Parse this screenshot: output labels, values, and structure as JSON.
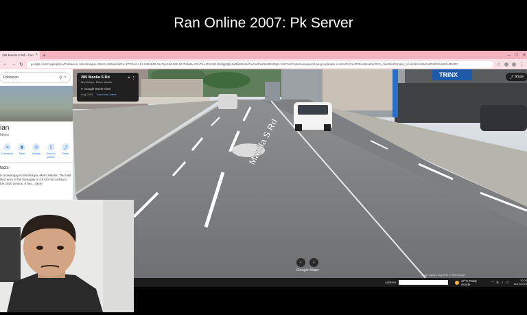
{
  "stream": {
    "title": "Ran Online 2007: Pk Server"
  },
  "browser": {
    "tab_label": "285 Manila S Rd - Google Maps",
    "url": "google.com/maps/place/Poblacion,+Muntinlupa,+Metro+Manila/@14.3770110,121.0464565,3a,75y,346.05h,90.7t/data=!3m7!1e1!3m5!1sMUjgNjwUwlBkWmU4CuCw0hw!2e0!6shttps:%2F%2Fstreetviewpixels-pa.googleapis.com%2Fv1%2Fthumbnail%3Fcb_client%3Dmaps_sv.tactile%26w%3D900%26h%3D600",
    "new_tab": "+"
  },
  "streetview": {
    "address": "285 Manila S Rd",
    "city": "Muntinlupa, Metro Manila",
    "provider": "Google Street View",
    "date": "Aug 2024",
    "see_more": "See more dates",
    "share_label": "Share",
    "road_label": "Manila S Rd",
    "logo": "Google Maps",
    "credit": "Image capture: Aug 2024  © 2025 Google"
  },
  "panel": {
    "search_value": "Poblacion",
    "place_name": "ian",
    "place_sub": "Metro",
    "actions": [
      {
        "label": "Directions",
        "icon": "directions-icon"
      },
      {
        "label": "Save",
        "icon": "bookmark-icon"
      },
      {
        "label": "Nearby",
        "icon": "nearby-icon"
      },
      {
        "label": "Send to phone",
        "icon": "phone-icon"
      },
      {
        "label": "Share",
        "icon": "share-icon"
      }
    ],
    "facts_title": "facts",
    "facts_text": "is a barangay in Muntinlupa, Metro Manila. The total land area of the barangay is 4.5 km² according to the 2020 census. It has... More"
  },
  "taskbar": {
    "address_label": "Address",
    "weather": "27°C  Partly cloudy",
    "time": "10:06",
    "date": "11/12/2025"
  }
}
